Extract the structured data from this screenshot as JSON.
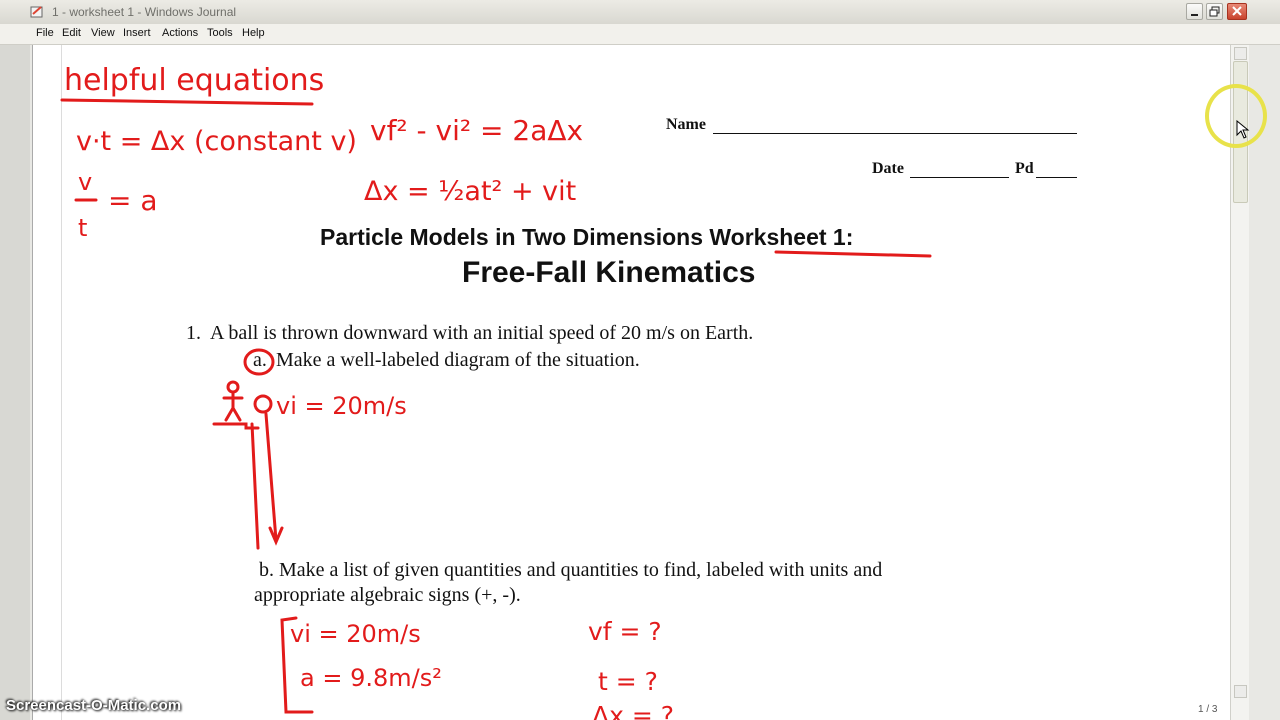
{
  "window": {
    "title": "1 - worksheet 1 - Windows Journal"
  },
  "menu": [
    "File",
    "Edit",
    "View",
    "Insert",
    "Actions",
    "Tools",
    "Help"
  ],
  "header": {
    "name_label": "Name",
    "date_label": "Date",
    "pd_label": "Pd"
  },
  "worksheet": {
    "subtitle": "Particle Models in Two Dimensions Worksheet 1:",
    "title": "Free-Fall Kinematics",
    "q1_number": "1.",
    "q1_text": "A ball is thrown downward with an initial speed of 20 m/s on Earth.",
    "q1a_label": "a.",
    "q1a_text": "Make a well-labeled diagram of the situation.",
    "q1b_line1": "b. Make a list of given quantities and quantities to find, labeled with units and",
    "q1b_line2": "appropriate algebraic signs (+, -)."
  },
  "ink": {
    "heading": "helpful equations",
    "eq1": "v·t = Δx (constant v)",
    "eq2_num": "v",
    "eq2_den": "t",
    "eq2_rhs": "= a",
    "eq3": "vf² - vi² = 2aΔx",
    "eq4": "Δx = ½at² + vit",
    "diagram_label": "vi = 20m/s",
    "given1": "vi = 20m/s",
    "given2": "a = 9.8m/s²",
    "find1": "vf = ?",
    "find2": "t = ?",
    "find3": "Δx = ?"
  },
  "status": {
    "page": "1 / 3",
    "watermark": "Screencast-O-Matic.com"
  },
  "colors": {
    "ink": "#e21b1b",
    "titlebar": "#dcdbd4",
    "cursor_highlight": "#e8e24a"
  },
  "icons": [
    "journal-app-icon",
    "minimize-icon",
    "maximize-icon",
    "close-icon",
    "mouse-cursor-icon"
  ]
}
